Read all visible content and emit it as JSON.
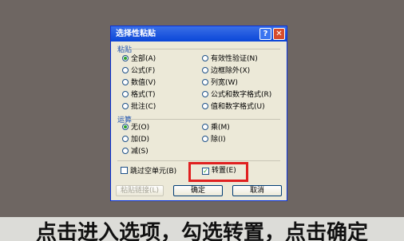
{
  "dialog": {
    "title": "选择性粘贴",
    "help_glyph": "?",
    "close_glyph": "✕",
    "paste_group": {
      "label": "粘贴",
      "left": [
        "全部(A)",
        "公式(F)",
        "数值(V)",
        "格式(T)",
        "批注(C)"
      ],
      "right": [
        "有效性验证(N)",
        "边框除外(X)",
        "列宽(W)",
        "公式和数字格式(R)",
        "值和数字格式(U)"
      ],
      "selected": "全部(A)"
    },
    "operation_group": {
      "label": "运算",
      "left": [
        "无(O)",
        "加(D)",
        "减(S)"
      ],
      "right": [
        "乘(M)",
        "除(I)"
      ],
      "selected": "无(O)"
    },
    "skip_blanks_label": "跳过空单元(B)",
    "transpose_label": "转置(E)",
    "transpose_checked": true,
    "paste_link_label": "粘贴链接(L)",
    "ok_label": "确定",
    "cancel_label": "取消"
  },
  "caption": "点击进入选项，勾选转置，点击确定",
  "colors": {
    "highlight": "#e02020",
    "titlebar": "#0a46d8",
    "background": "#6e6662"
  }
}
